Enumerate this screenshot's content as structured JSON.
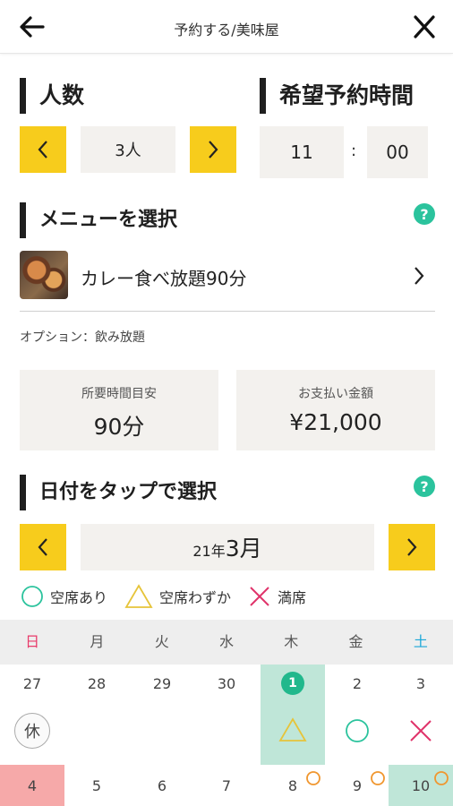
{
  "header": {
    "title": "予約する/美味屋",
    "back_icon": "arrow-left-icon",
    "close_icon": "close-icon"
  },
  "people": {
    "heading": "人数",
    "value": "3人",
    "prev": "<",
    "next": ">"
  },
  "time": {
    "heading": "希望予約時間",
    "hour": "11",
    "separator": ":",
    "minute": "00"
  },
  "menu": {
    "heading": "メニューを選択",
    "item_name": "カレー食べ放題90分",
    "option": "オプション：飲み放題"
  },
  "summary": {
    "duration_label": "所要時間目安",
    "duration_value": "90分",
    "price_label": "お支払い金額",
    "price_value": "¥21,000"
  },
  "date": {
    "heading": "日付をタップで選択",
    "month_year_prefix": "21年",
    "month": "3月"
  },
  "legend": {
    "available": "空席あり",
    "few": "空席わずか",
    "full": "満席"
  },
  "calendar": {
    "weekdays": [
      "日",
      "月",
      "火",
      "水",
      "木",
      "金",
      "土"
    ],
    "row1": [
      "27",
      "28",
      "29",
      "30",
      "1",
      "2",
      "3"
    ],
    "row2": [
      "4",
      "5",
      "6",
      "7",
      "8",
      "9",
      "10"
    ],
    "holiday_label": "休"
  },
  "colors": {
    "accent_yellow": "#f7cc1c",
    "teal": "#2bc39d",
    "sunday": "#e83a6a",
    "saturday": "#1aa7d8"
  }
}
